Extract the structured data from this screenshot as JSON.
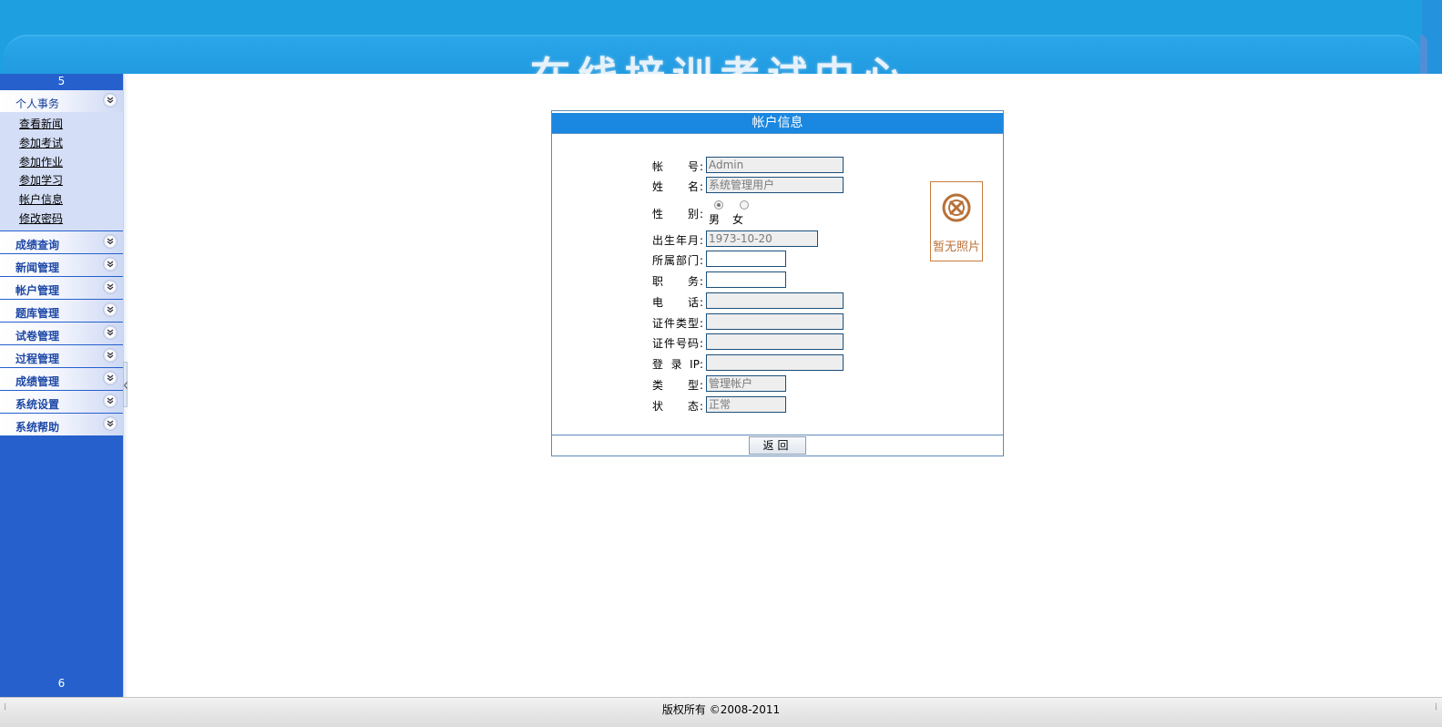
{
  "header": {
    "title": "在线培训考试中心"
  },
  "sidebar": {
    "top_number": "5",
    "bottom_number": "6",
    "expanded_menu": {
      "title": "个人事务",
      "items": [
        "查看新闻",
        "参加考试",
        "参加作业",
        "参加学习",
        "帐户信息",
        "修改密码"
      ]
    },
    "menus": [
      "成绩查询",
      "新闻管理",
      "帐户管理",
      "题库管理",
      "试卷管理",
      "过程管理",
      "成绩管理",
      "系统设置",
      "系统帮助"
    ],
    "chevron_glyph": "»"
  },
  "panel": {
    "title": "帐户信息",
    "fields": {
      "account": {
        "label": "帐　　号:",
        "value": "Admin"
      },
      "name": {
        "label": "姓　　名:",
        "value": "系统管理用户"
      },
      "gender": {
        "label": "性　　别:",
        "options": [
          "男",
          "女"
        ],
        "selected": "男"
      },
      "birth": {
        "label": "出生年月:",
        "value": "1973-10-20"
      },
      "dept": {
        "label": "所属部门:",
        "value": ""
      },
      "position": {
        "label": "职　　务:",
        "value": ""
      },
      "phone": {
        "label": "电　　话:",
        "value": ""
      },
      "id_type": {
        "label": "证件类型:",
        "value": ""
      },
      "id_no": {
        "label": "证件号码:",
        "value": ""
      },
      "login_ip": {
        "label": "登 录 IP:",
        "value": ""
      },
      "type": {
        "label": "类　　型:",
        "value": "管理帐户"
      },
      "status": {
        "label": "状　　态:",
        "value": "正常"
      }
    },
    "photo": {
      "text": "暂无照片"
    },
    "back_button": "返回"
  },
  "footer": {
    "copyright": "版权所有 ©2008-2011"
  },
  "colors": {
    "header_bg": "#1e9fe0",
    "sidebar_bg": "#2560cc",
    "panel_title_bg": "#1a88e0",
    "photo_border": "#c87b3c"
  }
}
